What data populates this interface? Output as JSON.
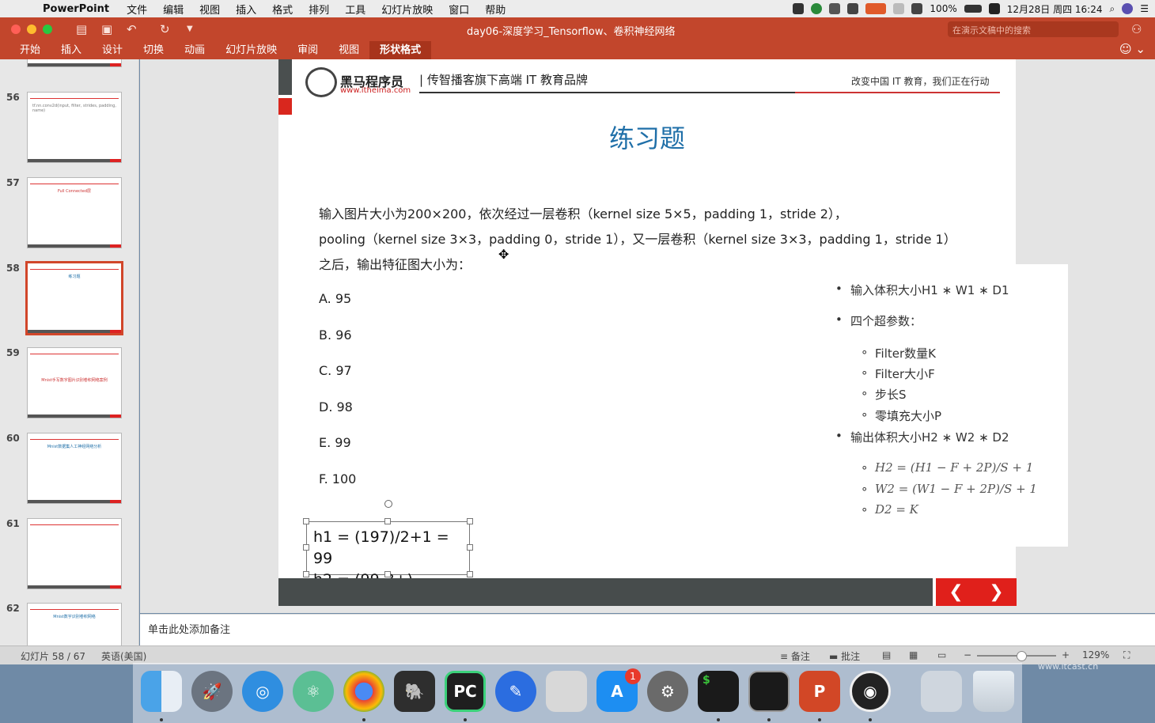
{
  "menubar": {
    "app": "PowerPoint",
    "items": [
      "文件",
      "编辑",
      "视图",
      "插入",
      "格式",
      "排列",
      "工具",
      "幻灯片放映",
      "窗口",
      "帮助"
    ],
    "battery": "100%",
    "clock": "12月28日 周四 16:24"
  },
  "window": {
    "title": "day06-深度学习_Tensorflow、卷积神经网络",
    "search_placeholder": "在演示文稿中的搜索"
  },
  "ribbon": {
    "tabs": [
      "开始",
      "插入",
      "设计",
      "切换",
      "动画",
      "幻灯片放映",
      "审阅",
      "视图",
      "形状格式"
    ],
    "active": "形状格式"
  },
  "thumbnails": [
    {
      "num": "56",
      "text": "tf.nn.conv2d(input, filter, strides, padding, name)"
    },
    {
      "num": "57",
      "text": "Full Connected层"
    },
    {
      "num": "58",
      "text": "练习题",
      "selected": true
    },
    {
      "num": "59",
      "text": "Mnist手写数字图片识别卷积网络案例"
    },
    {
      "num": "60",
      "text": "Mnist数据集人工神经网络分析"
    },
    {
      "num": "61",
      "text": ""
    },
    {
      "num": "62",
      "text": "Mnist数字识别卷积网络"
    }
  ],
  "slide": {
    "brand_name": "黑马程序员",
    "brand_url": "www.itheima.com",
    "slogan": "| 传智播客旗下高端 IT 教育品牌",
    "tagline": "改变中国 IT 教育，我们正在行动",
    "title": "练习题",
    "question": [
      "输入图片大小为200×200，依次经过一层卷积（kernel size 5×5，padding 1，stride 2），",
      "pooling（kernel size 3×3，padding 0，stride 1），又一层卷积（kernel size 3×3，padding 1，stride 1）",
      "之后，输出特征图大小为："
    ],
    "options": [
      "A. 95",
      "B. 96",
      "C. 97",
      "D. 98",
      "E. 99",
      "F. 100"
    ],
    "textbox": [
      "h1 = (197)/2+1 = 99",
      "h2 = (99-3+)"
    ],
    "nav_prev": "❮",
    "nav_next": "❯"
  },
  "panel": {
    "b1": "输入体积大小H1 ∗ W1 ∗ D1",
    "b2": "四个超参数：",
    "s1": "Filter数量K",
    "s2": "Filter大小F",
    "s3": "步长S",
    "s4": "零填充大小P",
    "b3": "输出体积大小H2 ∗ W2 ∗ D2",
    "f1": "H2 = (H1 − F + 2P)/S + 1",
    "f2": "W2 = (W1 − F + 2P)/S + 1",
    "f3": "D2 = K"
  },
  "notes": {
    "placeholder": "单击此处添加备注"
  },
  "status": {
    "slide": "幻灯片 58 / 67",
    "lang": "英语(美国)",
    "notes_btn": "备注",
    "comments_btn": "批注",
    "zoom": "129%"
  },
  "dock": {
    "badge": "1",
    "pycharm": "PC",
    "powerpoint": "P",
    "terminal": "$"
  },
  "watermark": "www.itcast.cn"
}
